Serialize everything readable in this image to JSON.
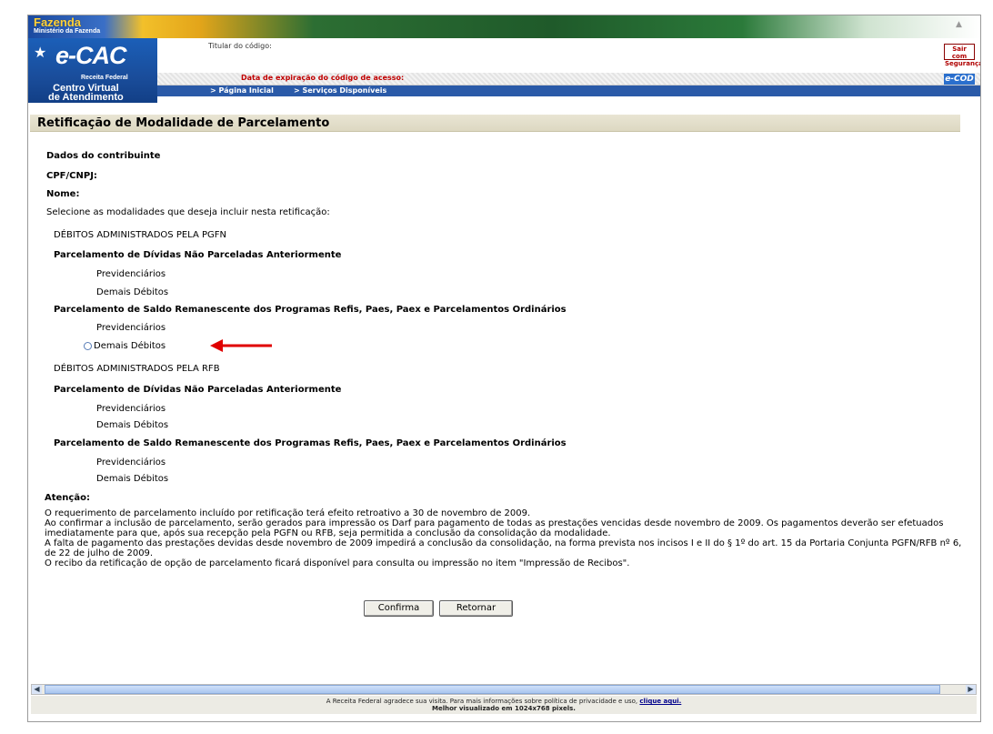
{
  "header": {
    "banner_title": "Fazenda",
    "banner_subtitle": "Ministério da Fazenda",
    "logo_title": "e-CAC",
    "logo_org": "Receita Federal",
    "logo_subtitle_1": "Centro Virtual",
    "logo_subtitle_2": "de Atendimento",
    "titular_label": "Titular do código:",
    "expiration_label": "Data de expiração do código de acesso:",
    "exit_button": "Sair com Segurança",
    "ecod_button": "e-COD",
    "nav": [
      "> Página Inicial",
      "> Serviços Disponíveis"
    ]
  },
  "page": {
    "title": "Retificação de Modalidade de Parcelamento",
    "taxpayer_heading": "Dados do contribuinte",
    "cpf_label": "CPF/CNPJ:",
    "name_label": "Nome:",
    "instruction": "Selecione as modalidades que deseja incluir nesta retificação:"
  },
  "sections": [
    {
      "heading": "DÉBITOS ADMINISTRADOS PELA PGFN",
      "groups": [
        {
          "title": "Parcelamento de Dívidas Não Parceladas Anteriormente",
          "items": [
            "Previdenciários",
            "Demais Débitos"
          ]
        },
        {
          "title": "Parcelamento de Saldo Remanescente dos Programas Refis, Paes, Paex e Parcelamentos Ordinários",
          "items": [
            "Previdenciários",
            "Demais Débitos"
          ]
        }
      ]
    },
    {
      "heading": "DÉBITOS ADMINISTRADOS PELA RFB",
      "groups": [
        {
          "title": "Parcelamento de Dívidas Não Parceladas Anteriormente",
          "items": [
            "Previdenciários",
            "Demais Débitos"
          ]
        },
        {
          "title": "Parcelamento de Saldo Remanescente dos Programas Refis, Paes, Paex e Parcelamentos Ordinários",
          "items": [
            "Previdenciários",
            "Demais Débitos"
          ]
        }
      ]
    }
  ],
  "attention": {
    "title": "Atenção:",
    "lines": [
      "O requerimento de parcelamento incluído por retificação terá efeito retroativo a 30 de novembro de 2009.",
      "Ao confirmar a inclusão de parcelamento, serão gerados para impressão os Darf para pagamento de todas as prestações vencidas desde novembro de 2009. Os pagamentos deverão ser efetuados imediatamente para que, após sua recepção pela PGFN ou RFB, seja permitida a conclusão da consolidação da modalidade.",
      "A falta de pagamento das prestações devidas desde novembro de 2009 impedirá a conclusão da consolidação, na forma prevista nos incisos I e II do § 1º do art. 15 da Portaria Conjunta PGFN/RFB nº 6, de 22 de julho de 2009.",
      "O recibo da retificação de opção de parcelamento ficará disponível para consulta ou impressão no item \"Impressão de Recibos\"."
    ]
  },
  "buttons": {
    "confirm": "Confirma",
    "back": "Retornar"
  },
  "footer": {
    "line1": "A Receita Federal agradece sua visita. Para mais informações sobre política de privacidade e uso,",
    "link": "clique aqui.",
    "line2": "Melhor visualizado em 1024x768 pixels."
  },
  "colors": {
    "arrow": "#e00000",
    "nav": "#2a5aa8",
    "title_bar": "#e3dfca"
  }
}
